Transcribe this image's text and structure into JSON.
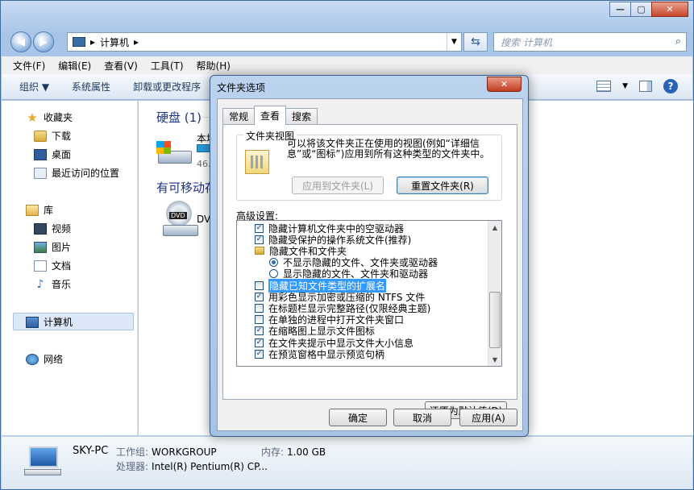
{
  "window": {
    "caption_buttons": [
      "—",
      "▢",
      "✕"
    ]
  },
  "nav": {
    "address_label": "计算机",
    "address_separator": "▸",
    "search_placeholder": "搜索 计算机"
  },
  "menu": [
    "文件(F)",
    "编辑(E)",
    "查看(V)",
    "工具(T)",
    "帮助(H)"
  ],
  "toolbar": [
    "组织 ▼",
    "系统属性",
    "卸载或更改程序"
  ],
  "sidebar": {
    "favorites": "收藏夹",
    "fav_items": [
      "下载",
      "桌面",
      "最近访问的位置"
    ],
    "libraries": "库",
    "lib_items": [
      "视频",
      "图片",
      "文档",
      "音乐"
    ],
    "computer": "计算机",
    "network": "网络"
  },
  "content": {
    "hdd_group": "硬盘 (1)",
    "hdd_partial_name": "本地",
    "hdd_partial_size": "46.",
    "removable_group": "有可移动存",
    "dvd_partial": "DV",
    "dvd_badge": "DVD"
  },
  "status": {
    "pc_name": "SKY-PC",
    "workgroup_key": "工作组:",
    "workgroup_val": "WORKGROUP",
    "memory_key": "内存:",
    "memory_val": "1.00 GB",
    "cpu_key": "处理器:",
    "cpu_val": "Intel(R) Pentium(R) CP..."
  },
  "dialog": {
    "title": "文件夹选项",
    "close": "✕",
    "tabs": [
      "常规",
      "查看",
      "搜索"
    ],
    "folder_views_legend": "文件夹视图",
    "folder_views_text": "可以将该文件夹正在使用的视图(例如“详细信息”或“图标”)应用到所有这种类型的文件夹中。",
    "apply_to_folders": "应用到文件夹(L)",
    "reset_folders": "重置文件夹(R)",
    "advanced_label": "高级设置:",
    "items": [
      {
        "type": "check",
        "checked": true,
        "indent": 0,
        "label": "隐藏计算机文件夹中的空驱动器"
      },
      {
        "type": "check",
        "checked": true,
        "indent": 0,
        "label": "隐藏受保护的操作系统文件(推荐)"
      },
      {
        "type": "folder",
        "indent": 0,
        "label": "隐藏文件和文件夹"
      },
      {
        "type": "radio",
        "checked": true,
        "indent": 1,
        "label": "不显示隐藏的文件、文件夹或驱动器"
      },
      {
        "type": "radio",
        "checked": false,
        "indent": 1,
        "label": "显示隐藏的文件、文件夹和驱动器"
      },
      {
        "type": "check",
        "checked": false,
        "indent": 0,
        "label": "隐藏已知文件类型的扩展名",
        "selected": true
      },
      {
        "type": "check",
        "checked": true,
        "indent": 0,
        "label": "用彩色显示加密或压缩的 NTFS 文件"
      },
      {
        "type": "check",
        "checked": false,
        "indent": 0,
        "label": "在标题栏显示完整路径(仅限经典主题)"
      },
      {
        "type": "check",
        "checked": false,
        "indent": 0,
        "label": "在单独的进程中打开文件夹窗口"
      },
      {
        "type": "check",
        "checked": true,
        "indent": 0,
        "label": "在缩略图上显示文件图标"
      },
      {
        "type": "check",
        "checked": true,
        "indent": 0,
        "label": "在文件夹提示中显示文件大小信息"
      },
      {
        "type": "check",
        "checked": true,
        "indent": 0,
        "label": "在预览窗格中显示预览句柄"
      }
    ],
    "restore_defaults": "还原为默认值(D)",
    "ok": "确定",
    "cancel": "取消",
    "apply": "应用(A)"
  }
}
